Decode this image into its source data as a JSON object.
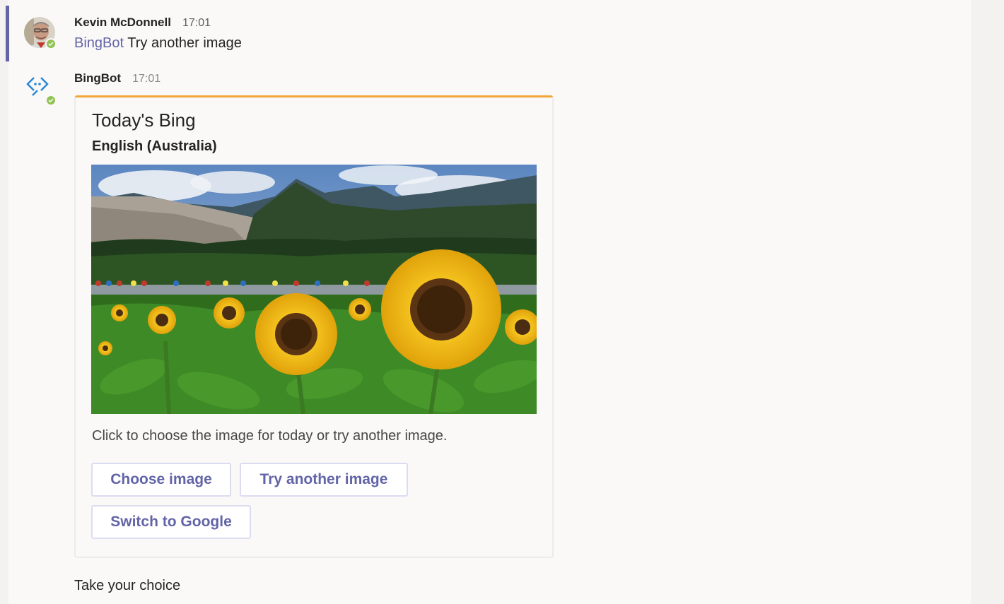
{
  "messages": [
    {
      "author": "Kevin McDonnell",
      "time": "17:01",
      "mention": "BingBot",
      "text": "Try another image"
    },
    {
      "author": "BingBot",
      "time": "17:01"
    }
  ],
  "card": {
    "title": "Today's Bing",
    "subtitle": "English (Australia)",
    "image_icon": "sunflowers-cyclists-photo",
    "text": "Click to choose the image for today or try another image.",
    "buttons": {
      "choose": "Choose image",
      "try_another": "Try another image",
      "switch_google": "Switch to Google"
    },
    "accent_color": "#f2a63a"
  },
  "footer_text": "Take your choice",
  "colors": {
    "brand": "#6264a7",
    "presence_available": "#92c353"
  }
}
